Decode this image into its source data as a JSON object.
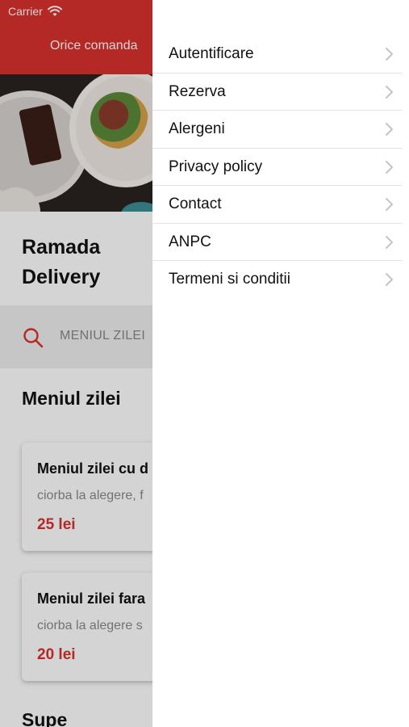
{
  "status_bar": {
    "carrier": "Carrier"
  },
  "header": {
    "title": "Orice comanda"
  },
  "restaurant": {
    "name": "Ramada Delivery"
  },
  "search": {
    "text": "MENIUL ZILEI"
  },
  "section": {
    "title": "Meniul zilei"
  },
  "cards": [
    {
      "title": "Meniul zilei cu d",
      "description": "ciorba la alegere, f",
      "price": "25 lei"
    },
    {
      "title": "Meniul zilei fara",
      "description": "ciorba la alegere s",
      "price": "20 lei"
    }
  ],
  "next_section": {
    "title": "Supe"
  },
  "drawer": {
    "items": [
      {
        "label": "Autentificare"
      },
      {
        "label": "Rezerva"
      },
      {
        "label": "Alergeni"
      },
      {
        "label": "Privacy policy"
      },
      {
        "label": "Contact"
      },
      {
        "label": "ANPC"
      },
      {
        "label": "Termeni si conditii"
      }
    ]
  },
  "colors": {
    "accent": "#d9322e",
    "text": "#111111",
    "muted": "#8a8a8a"
  }
}
